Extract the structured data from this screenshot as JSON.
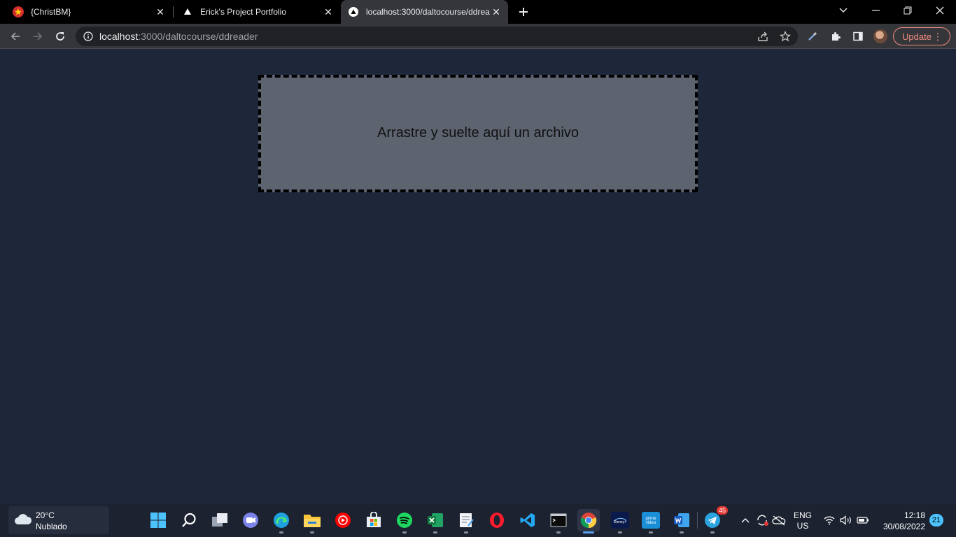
{
  "browser": {
    "tabs": [
      {
        "title": "{ChristBM}",
        "icon": "star-favicon-icon",
        "active": false
      },
      {
        "title": "Erick's Project Portfolio",
        "icon": "triangle-favicon-icon",
        "active": false
      },
      {
        "title": "localhost:3000/daltocourse/ddreader",
        "icon": "triangle-favicon-icon",
        "active": true
      }
    ],
    "url_host": "localhost",
    "url_path": ":3000/daltocourse/ddreader",
    "update_label": "Update"
  },
  "page": {
    "dropzone_text": "Arrastre y suelte aquí un archivo",
    "background_color": "#1e2739",
    "dropzone_color": "#5d6470"
  },
  "taskbar": {
    "weather_temp": "20°C",
    "weather_condition": "Nublado",
    "apps": [
      "start-icon",
      "search-icon",
      "task-view-icon",
      "teams-chat-icon",
      "edge-icon",
      "file-explorer-icon",
      "youtube-music-icon",
      "microsoft-store-icon",
      "spotify-icon",
      "excel-icon",
      "notepad-icon",
      "opera-icon",
      "vscode-icon",
      "terminal-icon",
      "chrome-icon",
      "disney-plus-icon",
      "prime-video-icon",
      "word-icon",
      "telegram-icon"
    ],
    "telegram_badge": "45",
    "lang_line1": "ENG",
    "lang_line2": "US",
    "time": "12:18",
    "date": "30/08/2022",
    "notification_count": "21"
  }
}
